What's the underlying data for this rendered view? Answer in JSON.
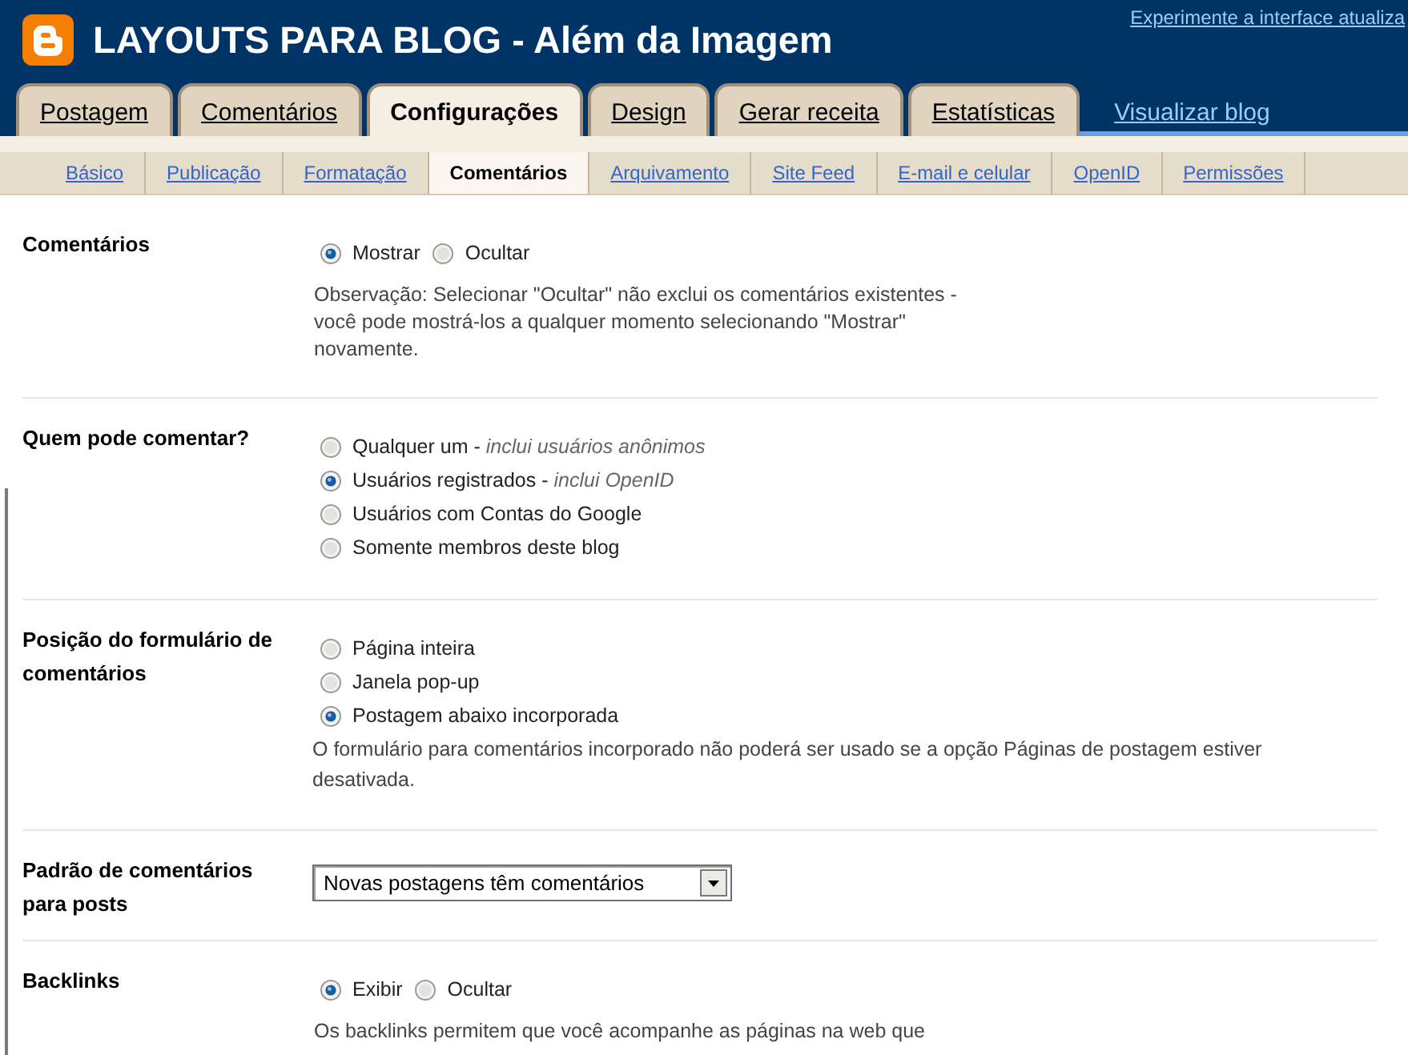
{
  "header": {
    "title": "LAYOUTS PARA BLOG - Além da Imagem",
    "top_link": "Experimente a interface atualiza"
  },
  "tabs": [
    {
      "label": "Postagem",
      "selected": false
    },
    {
      "label": "Comentários",
      "selected": false
    },
    {
      "label": "Configurações",
      "selected": true
    },
    {
      "label": "Design",
      "selected": false
    },
    {
      "label": "Gerar receita",
      "selected": false
    },
    {
      "label": "Estatísticas",
      "selected": false
    }
  ],
  "view_blog_link": "Visualizar blog",
  "subtabs": [
    {
      "label": "Básico",
      "selected": false
    },
    {
      "label": "Publicação",
      "selected": false
    },
    {
      "label": "Formatação",
      "selected": false
    },
    {
      "label": "Comentários",
      "selected": true
    },
    {
      "label": "Arquivamento",
      "selected": false
    },
    {
      "label": "Site Feed",
      "selected": false
    },
    {
      "label": "E-mail e celular",
      "selected": false
    },
    {
      "label": "OpenID",
      "selected": false
    },
    {
      "label": "Permissões",
      "selected": false
    }
  ],
  "sections": [
    {
      "kind": "inline",
      "label": "Comentários",
      "options": [
        {
          "label": "Mostrar",
          "selected": true
        },
        {
          "label": "Ocultar",
          "selected": false
        }
      ],
      "note": "Observação: Selecionar \"Ocultar\" não exclui os comentários existentes - você pode mostrá-los a qualquer momento selecionando \"Mostrar\" novamente."
    },
    {
      "kind": "stacked",
      "label": "Quem pode comentar?",
      "options": [
        {
          "label": "Qualquer um - *inclui usuários anônimos*",
          "selected": false
        },
        {
          "label": "Usuários registrados - *inclui OpenID*",
          "selected": true
        },
        {
          "label": "Usuários com Contas do Google",
          "selected": false
        },
        {
          "label": "Somente membros deste blog",
          "selected": false
        }
      ]
    },
    {
      "kind": "stacked",
      "label": "Posição do formulário de comentários",
      "options": [
        {
          "label": "Página inteira",
          "selected": false
        },
        {
          "label": "Janela pop-up",
          "selected": false
        },
        {
          "label": "Postagem abaixo incorporada",
          "selected": true
        }
      ],
      "note": "O formulário para comentários incorporado não poderá ser usado se a opção Páginas de postagem estiver desativada."
    },
    {
      "kind": "dropdown",
      "label": "Padrão de comentários para posts",
      "value": "Novas postagens têm comentários"
    },
    {
      "kind": "inline",
      "label": "Backlinks",
      "options": [
        {
          "label": "Exibir",
          "selected": true
        },
        {
          "label": "Ocultar",
          "selected": false
        }
      ],
      "note": "Os backlinks permitem que você acompanhe as páginas na web que"
    }
  ]
}
